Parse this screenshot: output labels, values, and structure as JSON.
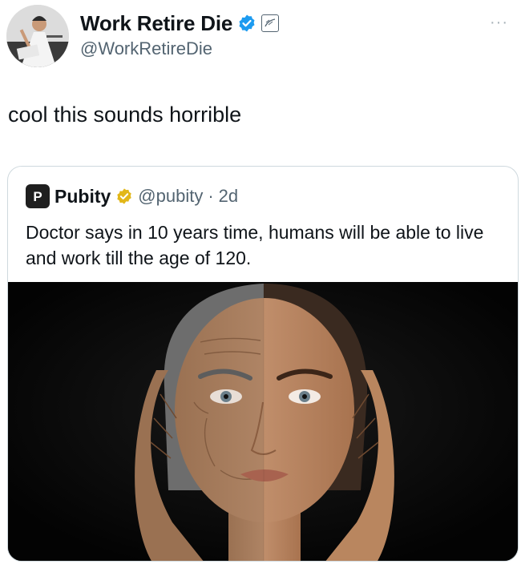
{
  "author": {
    "display_name": "Work Retire Die",
    "handle": "@WorkRetireDie",
    "verified_icon": "verified-badge-icon",
    "affiliate_icon": "affiliate-badge-icon",
    "more_icon": "more-options-icon",
    "more_glyph": "···"
  },
  "tweet": {
    "text": "cool this sounds horrible"
  },
  "quote": {
    "logo_letter": "P",
    "display_name": "Pubity",
    "verified_icon": "gold-verified-badge-icon",
    "handle": "@pubity",
    "separator": "·",
    "time": "2d",
    "text": "Doctor says in 10 years time, humans will be able to live and work till the age of 120.",
    "image": "half-aged-face-photo"
  },
  "colors": {
    "text": "#0f1419",
    "secondary": "#536471",
    "verified_blue": "#1d9bf0",
    "gold": "#e2b719",
    "card_border": "#cfd9de"
  }
}
